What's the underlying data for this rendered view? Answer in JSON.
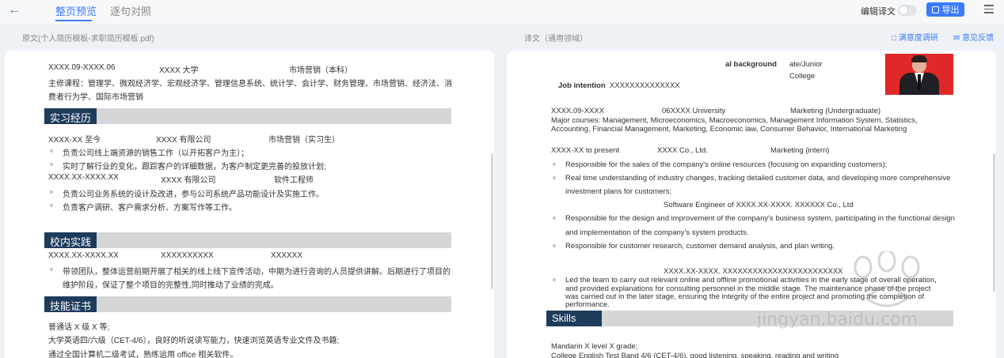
{
  "header": {
    "back_icon": "arrow-left-icon",
    "tabs": [
      {
        "label": "整页预览",
        "active": true
      },
      {
        "label": "逐句对照",
        "active": false
      }
    ],
    "edit_translation_label": "编辑译文",
    "export_label": "导出",
    "accent": "#3b7cff"
  },
  "subheader": {
    "source_label": "原文(个人简历模板-求职简历模板.pdf)",
    "target_label": "译文（通用领域）",
    "survey_label": "满意度调研",
    "feedback_label": "意见反馈"
  },
  "source": {
    "edu_row": [
      "XXXX.09-XXXX.06",
      "XXXX 大学",
      "市场营销（本科）"
    ],
    "courses_line1": "主修课程：管理学、微观经济学、宏观经济学、管理信息系统、统计学、会计学、财务管理、市场营销、经济法、消",
    "courses_line2": "费者行为学、国际市场营销",
    "section_internship": "实习经历",
    "intern_row": [
      "XXXX-XX 至今",
      "XXXX 有限公司",
      "市场营销（实习生）"
    ],
    "intern_bullets": [
      "负责公司线上端资源的销售工作（以开拓客户为主）；",
      "实时了解行业的变化，跟踪客户的详细数据，为客户制定更完善的投放计划;"
    ],
    "job_row": [
      "XXXX.XX-XXXX.XX",
      "XXXX 有限公司",
      "软件工程师"
    ],
    "job_bullets": [
      "负责公司业务系统的设计及改进，参与公司系统产品功能设计及实施工作。",
      "负责客户调研、客户需求分析、方案写作等工作。"
    ],
    "section_campus": "校内实践",
    "campus_row": [
      "XXXX.XX-XXXX.XX",
      "XXXXXXXXXX",
      "XXXXXX"
    ],
    "campus_bullet_line1": "带领团队，整体运营前期开展了相关的线上线下宣传活动，中期为进行咨询的人员提供讲解。后期进行了项目的",
    "campus_bullet_line2": "维护阶段，保证了整个项目的完整性,同时推动了业绩的完成。",
    "section_skills": "技能证书",
    "skills": [
      "普通话 X 级 X 等;",
      "大学英语四/六级（CET-4/6），良好的听说读写能力，快速浏览英语专业文件及书籍;",
      "通过全国计算机二级考试，熟练运用 office 相关软件。"
    ]
  },
  "target": {
    "top_col1": "al background",
    "top_col2_line1": "ate/Junior",
    "top_col2_line2": "College",
    "job_intention_label": "Job intention",
    "job_intention_value": "XXXXXXXXXXXXXX",
    "edu_row": [
      "XXXX.09-XXXX",
      "06XXXX University",
      "Marketing (Undergraduate)"
    ],
    "courses_line1": "Major courses: Management, Microeconomics, Macroeconomics, Management Information System, Statistics,",
    "courses_line2": "Accounting, Financial Management, Marketing, Economic law, Consumer Behavior, International Marketing",
    "intern_row": [
      "XXXX-XX to present",
      "XXXX Co., Ltd.",
      "Marketing (intern)"
    ],
    "intern_bullet1": "Responsible for the sales of the company's online resources (focusing on expanding customers);",
    "intern_bullet2_line1": "Real time understanding of industry changes, tracking detailed customer data, and developing more comprehensive",
    "intern_bullet2_line2": "investment plans for customers;",
    "job_title_line": "Software Engineer of XXXX.XX-XXXX. XXXXXX Co., Ltd",
    "job_bullet1_line1": "Responsible for the design and improvement of the company's business system, participating in the functional design",
    "job_bullet1_line2": "and implementation of the company's system products.",
    "job_bullet2": "Responsible for customer research, customer demand analysis, and plan writing.",
    "campus_row": "XXXX.XX-XXXX. XXXXXXXXXXXXXXXXXXXXXXXX",
    "campus_line1": "Led the team to carry out relevant online and offline promotional activities in the early stage of overall operation,",
    "campus_line2": "and provided explanations for consulting personnel in the middle stage. The maintenance phase of the project",
    "campus_line3": "was carried out in the later stage, ensuring the integrity of the entire project and promoting the completion of",
    "campus_line4": "performance.",
    "section_skills": "Skills",
    "skill1": "Mandarin X level X grade;",
    "skill2": "College English Test Band 4/6 (CET-4/6), good listening, speaking, reading and writing"
  },
  "watermark": "jingyan.baidu.com"
}
